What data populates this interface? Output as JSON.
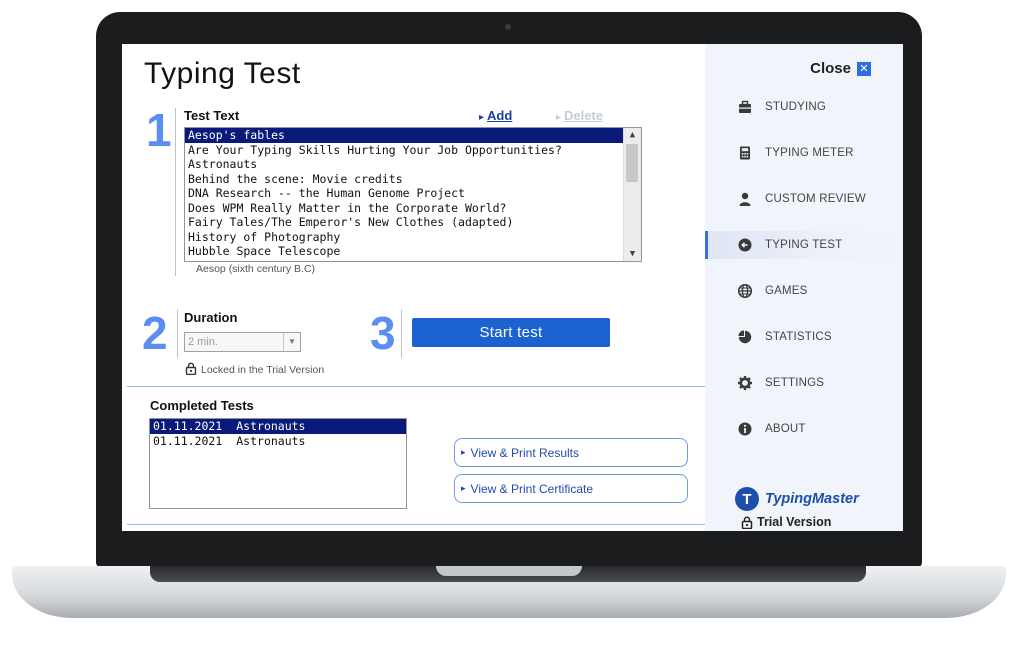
{
  "app": {
    "title": "Typing Test"
  },
  "steps": {
    "one": "1",
    "two": "2",
    "three": "3"
  },
  "test_text": {
    "label": "Test Text",
    "add_link": "Add",
    "delete_link": "Delete",
    "items": [
      "Aesop's fables",
      "Are Your Typing Skills Hurting Your Job Opportunities?",
      "Astronauts",
      "Behind the scene: Movie credits",
      "DNA Research -- the Human Genome Project",
      "Does WPM Really Matter in the Corporate World?",
      "Fairy Tales/The Emperor's New Clothes (adapted)",
      "History of Photography",
      "Hubble Space Telescope"
    ],
    "selected_index": 0,
    "source_caption": "Aesop (sixth century B.C)"
  },
  "duration": {
    "label": "Duration",
    "value": "2 min.",
    "locked_note": "Locked in the Trial Version"
  },
  "start_button": {
    "label": "Start test"
  },
  "completed_tests": {
    "label": "Completed Tests",
    "rows": [
      {
        "date": "01.11.2021",
        "name": "Astronauts"
      },
      {
        "date": "01.11.2021",
        "name": "Astronauts"
      }
    ],
    "selected_index": 0
  },
  "actions": {
    "view_results": "View & Print Results",
    "view_certificate": "View & Print Certificate"
  },
  "sidebar": {
    "close_label": "Close",
    "items": [
      {
        "label": "STUDYING",
        "icon": "briefcase-icon"
      },
      {
        "label": "TYPING METER",
        "icon": "calculator-icon"
      },
      {
        "label": "CUSTOM REVIEW",
        "icon": "user-icon"
      },
      {
        "label": "TYPING TEST",
        "icon": "arrow-circle-icon",
        "active": true
      },
      {
        "label": "GAMES",
        "icon": "globe-icon"
      },
      {
        "label": "STATISTICS",
        "icon": "pie-chart-icon"
      },
      {
        "label": "SETTINGS",
        "icon": "gear-icon"
      },
      {
        "label": "ABOUT",
        "icon": "info-icon"
      }
    ],
    "brand": "TypingMaster",
    "trial": "Trial Version"
  },
  "colors": {
    "accent": "#1b62d0",
    "selection": "#0a1a7a",
    "step_number": "#5a8ef0",
    "sidebar_bg": "#f1f4fa"
  }
}
